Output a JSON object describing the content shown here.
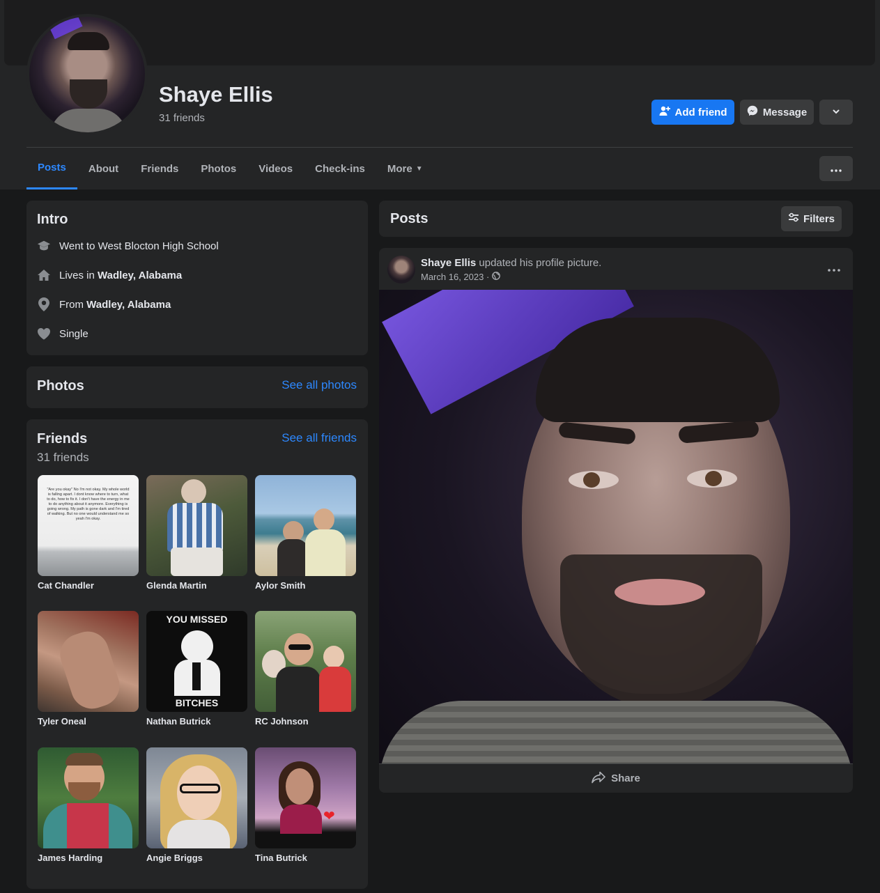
{
  "profile": {
    "name": "Shaye Ellis",
    "friend_count": "31 friends"
  },
  "actions": {
    "add_friend": "Add friend",
    "message": "Message"
  },
  "tabs": [
    {
      "label": "Posts",
      "active": true
    },
    {
      "label": "About"
    },
    {
      "label": "Friends"
    },
    {
      "label": "Photos"
    },
    {
      "label": "Videos"
    },
    {
      "label": "Check-ins"
    },
    {
      "label": "More"
    }
  ],
  "intro": {
    "title": "Intro",
    "school": "Went to West Blocton High School",
    "lives_prefix": "Lives in ",
    "lives_place": "Wadley, Alabama",
    "from_prefix": "From ",
    "from_place": "Wadley, Alabama",
    "relationship": "Single"
  },
  "photos": {
    "title": "Photos",
    "see_all": "See all photos"
  },
  "friends": {
    "title": "Friends",
    "count": "31 friends",
    "see_all": "See all friends",
    "list": [
      {
        "name": "Cat Chandler"
      },
      {
        "name": "Glenda Martin"
      },
      {
        "name": "Aylor Smith"
      },
      {
        "name": "Tyler Oneal"
      },
      {
        "name": "Nathan Butrick"
      },
      {
        "name": "RC Johnson"
      },
      {
        "name": "James Harding"
      },
      {
        "name": "Angie Briggs"
      },
      {
        "name": "Tina Butrick"
      }
    ],
    "cat_quote": "\"Are you okay\" No I'm not okay. My whole world is falling apart. I dont know where to turn, what to do, how to fix it. I don't have the energy in me to do anything about it anymore. Everything is going wrong. My path is gone dark and I'm tired of walking. But no one would understand me so yeah I'm okay.",
    "nathan_top": "YOU MISSED",
    "nathan_bottom": "BITCHES"
  },
  "posts": {
    "title": "Posts",
    "filters": "Filters",
    "post": {
      "author": "Shaye Ellis",
      "action": " updated his profile picture.",
      "date": "March 16, 2023 ·",
      "share": "Share"
    }
  },
  "colors": {
    "accent": "#1877f2",
    "link": "#2d88ff",
    "card": "#242526",
    "page": "#18191a"
  }
}
